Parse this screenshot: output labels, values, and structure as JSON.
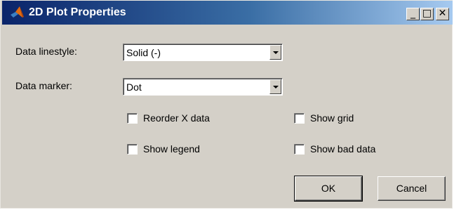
{
  "window": {
    "title": "2D Plot Properties",
    "minimize_symbol": "_",
    "maximize_symbol": "□",
    "close_symbol": "✕"
  },
  "form": {
    "linestyle_label": "Data linestyle:",
    "linestyle_value": "Solid (-)",
    "marker_label": "Data marker:",
    "marker_value": "Dot"
  },
  "checkboxes": {
    "reorder_x": {
      "label": "Reorder X data",
      "checked": false
    },
    "show_grid": {
      "label": "Show grid",
      "checked": false
    },
    "show_legend": {
      "label": "Show legend",
      "checked": false
    },
    "show_bad_data": {
      "label": "Show bad data",
      "checked": false
    }
  },
  "buttons": {
    "ok_label": "OK",
    "cancel_label": "Cancel"
  }
}
